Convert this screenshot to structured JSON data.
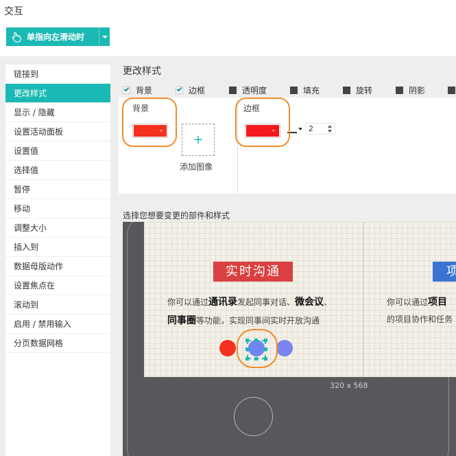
{
  "header": {
    "title": "交互"
  },
  "trigger": {
    "label": "单指向左滑动时",
    "icon": "hand-pointer-icon"
  },
  "actions": [
    {
      "label": "链接到"
    },
    {
      "label": "更改样式",
      "active": true
    },
    {
      "label": "显示 / 隐藏"
    },
    {
      "label": "设置活动面板"
    },
    {
      "label": "设置值"
    },
    {
      "label": "选择值"
    },
    {
      "label": "暂停"
    },
    {
      "label": "移动"
    },
    {
      "label": "调整大小"
    },
    {
      "label": "插入到"
    },
    {
      "label": "数据母版动作"
    },
    {
      "label": "设置焦点在"
    },
    {
      "label": "滚动到"
    },
    {
      "label": "启用 / 禁用输入"
    },
    {
      "label": "分页数据网格"
    }
  ],
  "panel": {
    "title": "更改样式",
    "checks": [
      {
        "label": "背景",
        "checked": true
      },
      {
        "label": "边框",
        "checked": true
      },
      {
        "label": "透明度",
        "checked": false
      },
      {
        "label": "填充",
        "checked": false
      },
      {
        "label": "旋转",
        "checked": false
      },
      {
        "label": "阴影",
        "checked": false
      }
    ],
    "background": {
      "label": "背景",
      "color": "#f4301e",
      "add_image_label": "添加图像",
      "add_icon": "+"
    },
    "border": {
      "label": "边框",
      "color": "#f5181e",
      "width": "2"
    },
    "section_title": "选择您想要变更的部件和样式"
  },
  "preview": {
    "card1": {
      "badge": "实时沟通",
      "badge_color": "#d9403f",
      "line1_pre": "你可以通过",
      "line1_bold": "通讯录",
      "line1_mid": "发起同事对话、",
      "line1_bold2": "微会议",
      "line1_post": "、",
      "line2_bold": "同事圈",
      "line2_post": "等功能，实现同事间实时开放沟通"
    },
    "card2": {
      "badge": "项",
      "badge_color": "#3a73d1",
      "line1_pre": "你可以通过",
      "line1_bold": "项目",
      "line2": "的项目协作和任务"
    },
    "dots": [
      "#f4301e",
      "#6e86f0",
      "#7b83f0"
    ],
    "size_label": "320 x 568"
  },
  "colors": {
    "accent": "#1bb9b4",
    "callout": "#f28c28"
  }
}
